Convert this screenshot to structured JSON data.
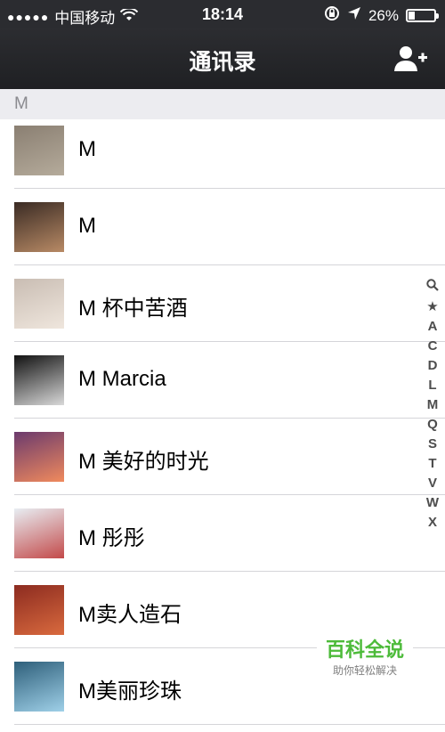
{
  "status_bar": {
    "signal": "●●●●●",
    "carrier": "中国移动",
    "time": "18:14",
    "battery": "26%",
    "battery_level": 0.26
  },
  "navbar": {
    "title": "通讯录",
    "add_icon": "add-contact-icon"
  },
  "section": {
    "letter": "M"
  },
  "contacts": [
    {
      "name": "M",
      "avatar_colors": [
        "#8a7f72",
        "#b5ab9b"
      ]
    },
    {
      "name": "M",
      "avatar_colors": [
        "#3a2b24",
        "#b88a65"
      ]
    },
    {
      "name": "M 杯中苦酒",
      "avatar_colors": [
        "#c9bdb3",
        "#efe6dd"
      ]
    },
    {
      "name": "M Marcia",
      "avatar_colors": [
        "#111111",
        "#d9d9d9"
      ]
    },
    {
      "name": "M 美好的时光",
      "avatar_colors": [
        "#6b3a6d",
        "#f08a5d"
      ]
    },
    {
      "name": "M 彤彤",
      "avatar_colors": [
        "#e8eef3",
        "#c34a4a"
      ]
    },
    {
      "name": "M卖人造石",
      "avatar_colors": [
        "#8c2b20",
        "#d96a3e"
      ]
    },
    {
      "name": "M美丽珍珠",
      "avatar_colors": [
        "#2e5f7a",
        "#9fd0e8"
      ]
    }
  ],
  "index_bar": [
    "search",
    "★",
    "A",
    "C",
    "D",
    "L",
    "M",
    "Q",
    "S",
    "T",
    "V",
    "W",
    "X"
  ],
  "watermark": {
    "main": "百科全说",
    "sub": "助你轻松解决"
  }
}
